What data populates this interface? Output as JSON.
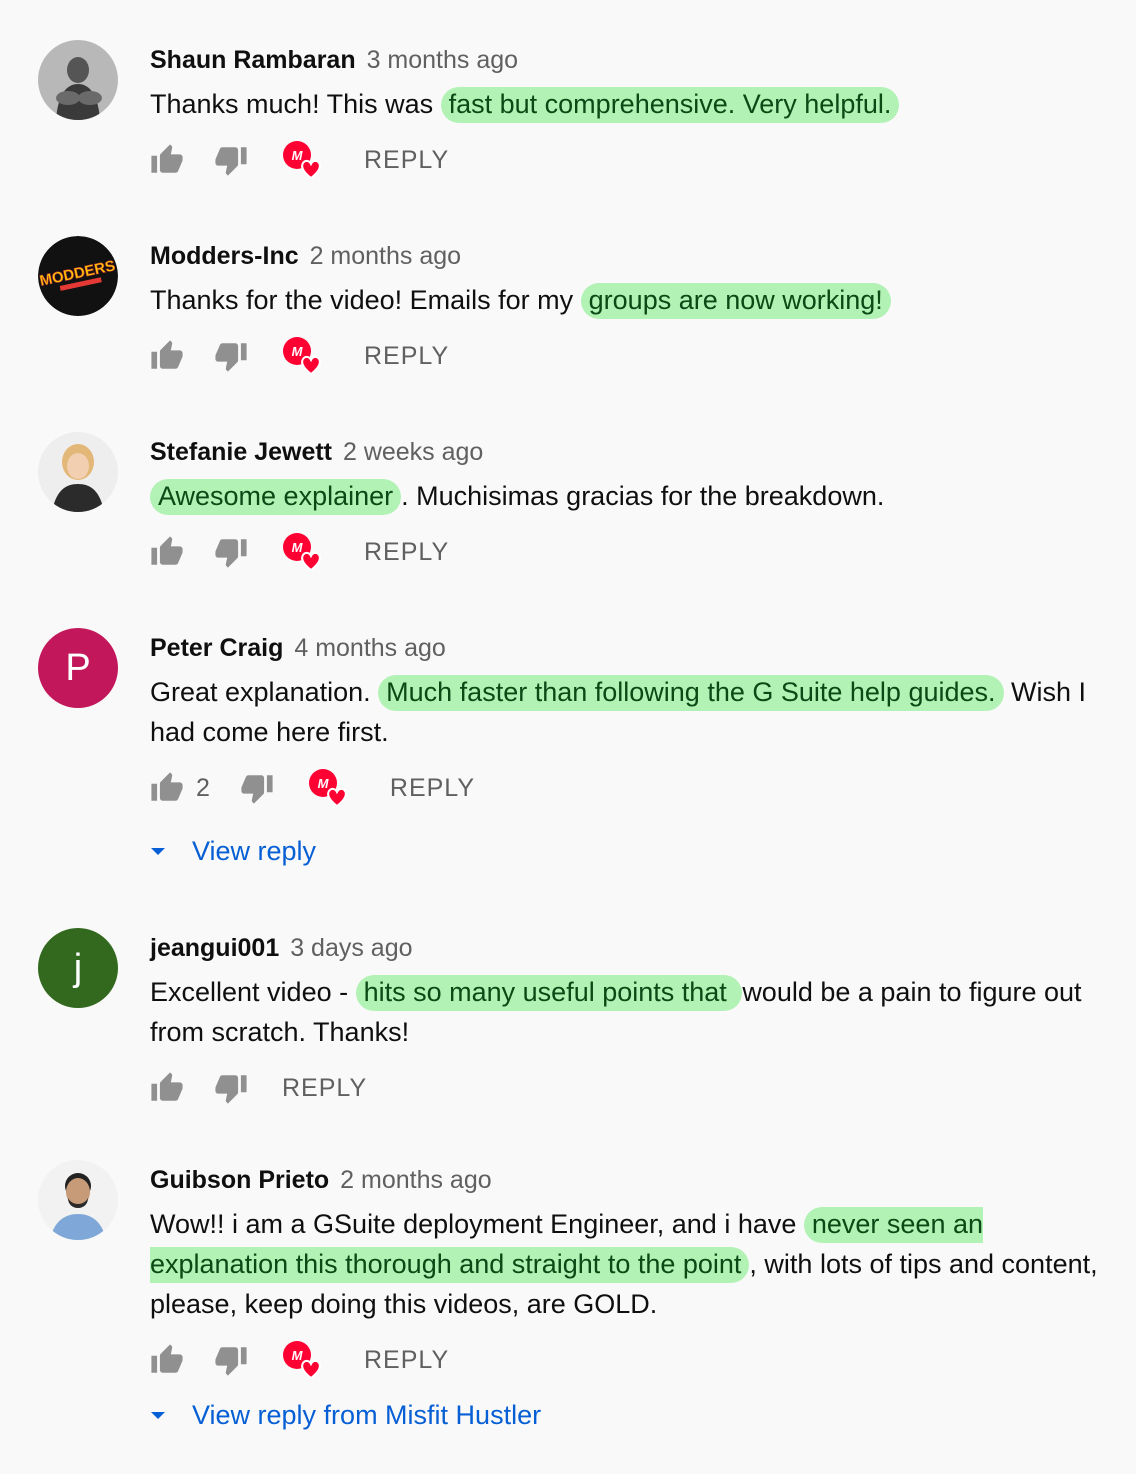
{
  "colors": {
    "highlight": "#b3f2b5",
    "link": "#065fd4",
    "muted": "#606060",
    "heart": "#ff0033"
  },
  "comments": [
    {
      "author": "Shaun Rambaran",
      "time": "3 months ago",
      "segments": [
        {
          "text": "Thanks much! This was ",
          "hl": false
        },
        {
          "text": "fast but comprehensive. Very helpful.",
          "hl": true
        }
      ],
      "reply_label": "REPLY",
      "hearted": true,
      "avatar": {
        "kind": "photo",
        "icon": "user-photo-icon"
      }
    },
    {
      "author": "Modders-Inc",
      "time": "2 months ago",
      "segments": [
        {
          "text": "Thanks for the video! Emails for my ",
          "hl": false
        },
        {
          "text": "groups are now working!",
          "hl": true
        }
      ],
      "reply_label": "REPLY",
      "hearted": true,
      "avatar": {
        "kind": "logo",
        "icon": "modders-logo-icon",
        "logo_text": "MODDERS"
      }
    },
    {
      "author": "Stefanie Jewett",
      "time": "2 weeks ago",
      "segments": [
        {
          "text": "Awesome explainer",
          "hl": true
        },
        {
          "text": ". Muchisimas gracias for the breakdown.",
          "hl": false
        }
      ],
      "reply_label": "REPLY",
      "hearted": true,
      "avatar": {
        "kind": "photo",
        "icon": "user-photo-icon"
      }
    },
    {
      "author": "Peter Craig",
      "time": "4 months ago",
      "segments": [
        {
          "text": "Great explanation. ",
          "hl": false
        },
        {
          "text": "Much faster than following the G Suite help guides.",
          "hl": true
        },
        {
          "text": " Wish I had come here first.",
          "hl": false
        }
      ],
      "like_count": "2",
      "reply_label": "REPLY",
      "hearted": true,
      "view_replies": "View reply",
      "avatar": {
        "kind": "letter",
        "letter": "P",
        "color": "#c2185b"
      }
    },
    {
      "author": "jeangui001",
      "time": "3 days ago",
      "segments": [
        {
          "text": "Excellent video - ",
          "hl": false
        },
        {
          "text": "hits so many useful points that ",
          "hl": true
        },
        {
          "text": "would be a pain to figure out from scratch. Thanks!",
          "hl": false
        }
      ],
      "reply_label": "REPLY",
      "hearted": false,
      "avatar": {
        "kind": "letter",
        "letter": "j",
        "color": "#33691e"
      }
    },
    {
      "author": "Guibson Prieto",
      "time": "2 months ago",
      "segments": [
        {
          "text": "Wow!! i am a GSuite deployment Engineer, and i have ",
          "hl": false
        },
        {
          "text": "never seen an explanation this thorough and straight to the point",
          "hl": true
        },
        {
          "text": ", with lots of tips and content, please, keep doing this videos, are GOLD.",
          "hl": false
        }
      ],
      "reply_label": "REPLY",
      "hearted": true,
      "view_replies": "View reply from Misfit Hustler",
      "avatar": {
        "kind": "photo",
        "icon": "user-photo-icon"
      }
    }
  ]
}
